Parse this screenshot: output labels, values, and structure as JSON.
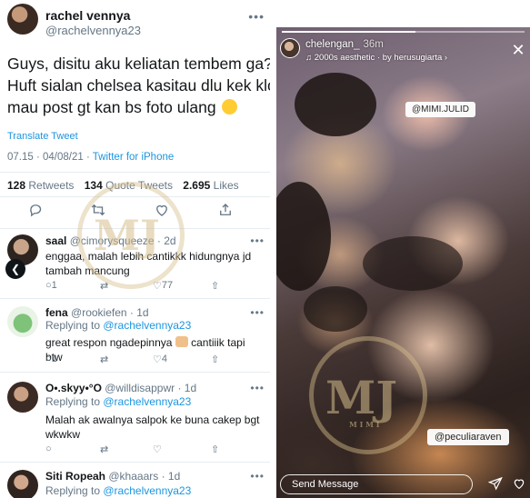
{
  "tweet": {
    "display_name": "rachel vennya",
    "handle": "@rachelvennya23",
    "text_lines": [
      "Guys, disitu aku keliatan tembem ga?",
      "Huft sialan chelsea kasitau dlu kek klo",
      "mau post gt kan bs foto ulang"
    ],
    "translate_label": "Translate Tweet",
    "time": "07.15 · 04/08/21 · ",
    "source": "Twitter for iPhone",
    "stats": {
      "retweets": "128",
      "retweets_label": "Retweets",
      "quotes": "134",
      "quotes_label": "Quote Tweets",
      "likes": "2.695",
      "likes_label": "Likes"
    }
  },
  "replies": [
    {
      "display_name": "saal",
      "handle": "@cimorysqueeze · 2d",
      "replying_prefix": "",
      "replying_to": "",
      "text": "enggaa, malah lebih cantikkk hidungnya jd tambah mancung",
      "reply_count": "1",
      "retweet_count": "",
      "like_count": "77"
    },
    {
      "display_name": "fena",
      "handle": "@rookiefen · 1d",
      "replying_prefix": "Replying to ",
      "replying_to": "@rachelvennya23",
      "text_a": "great respon ngadepinnya",
      "text_b": " cantiiik tapi btw",
      "reply_count": "1",
      "retweet_count": "",
      "like_count": "4"
    },
    {
      "display_name": "O•.skyy•°O",
      "handle": "@willdisappwr · 1d",
      "replying_prefix": "Replying to ",
      "replying_to": "@rachelvennya23",
      "text": "Malah ak awalnya salpok ke buna cakep bgt wkwkw",
      "reply_count": "",
      "retweet_count": "",
      "like_count": ""
    },
    {
      "display_name": "Siti Ropeah",
      "handle": "@khaaars · 1d",
      "replying_prefix": "Replying to ",
      "replying_to": "@rachelvennya23"
    }
  ],
  "watermark": {
    "letters": "MJ",
    "sub": "M I M I"
  },
  "story": {
    "username": "chelengan_",
    "age": "36m",
    "music": "♫ 2000s aesthetic · by herusugiarta ›",
    "tag_top": "@MIMI.JULID",
    "tag_bottom": "@peculiaraven",
    "send_placeholder": "Send Message",
    "progress": 0.55
  },
  "colors": {
    "link": "#1b95e0",
    "muted": "#657786",
    "text": "#14171a"
  }
}
